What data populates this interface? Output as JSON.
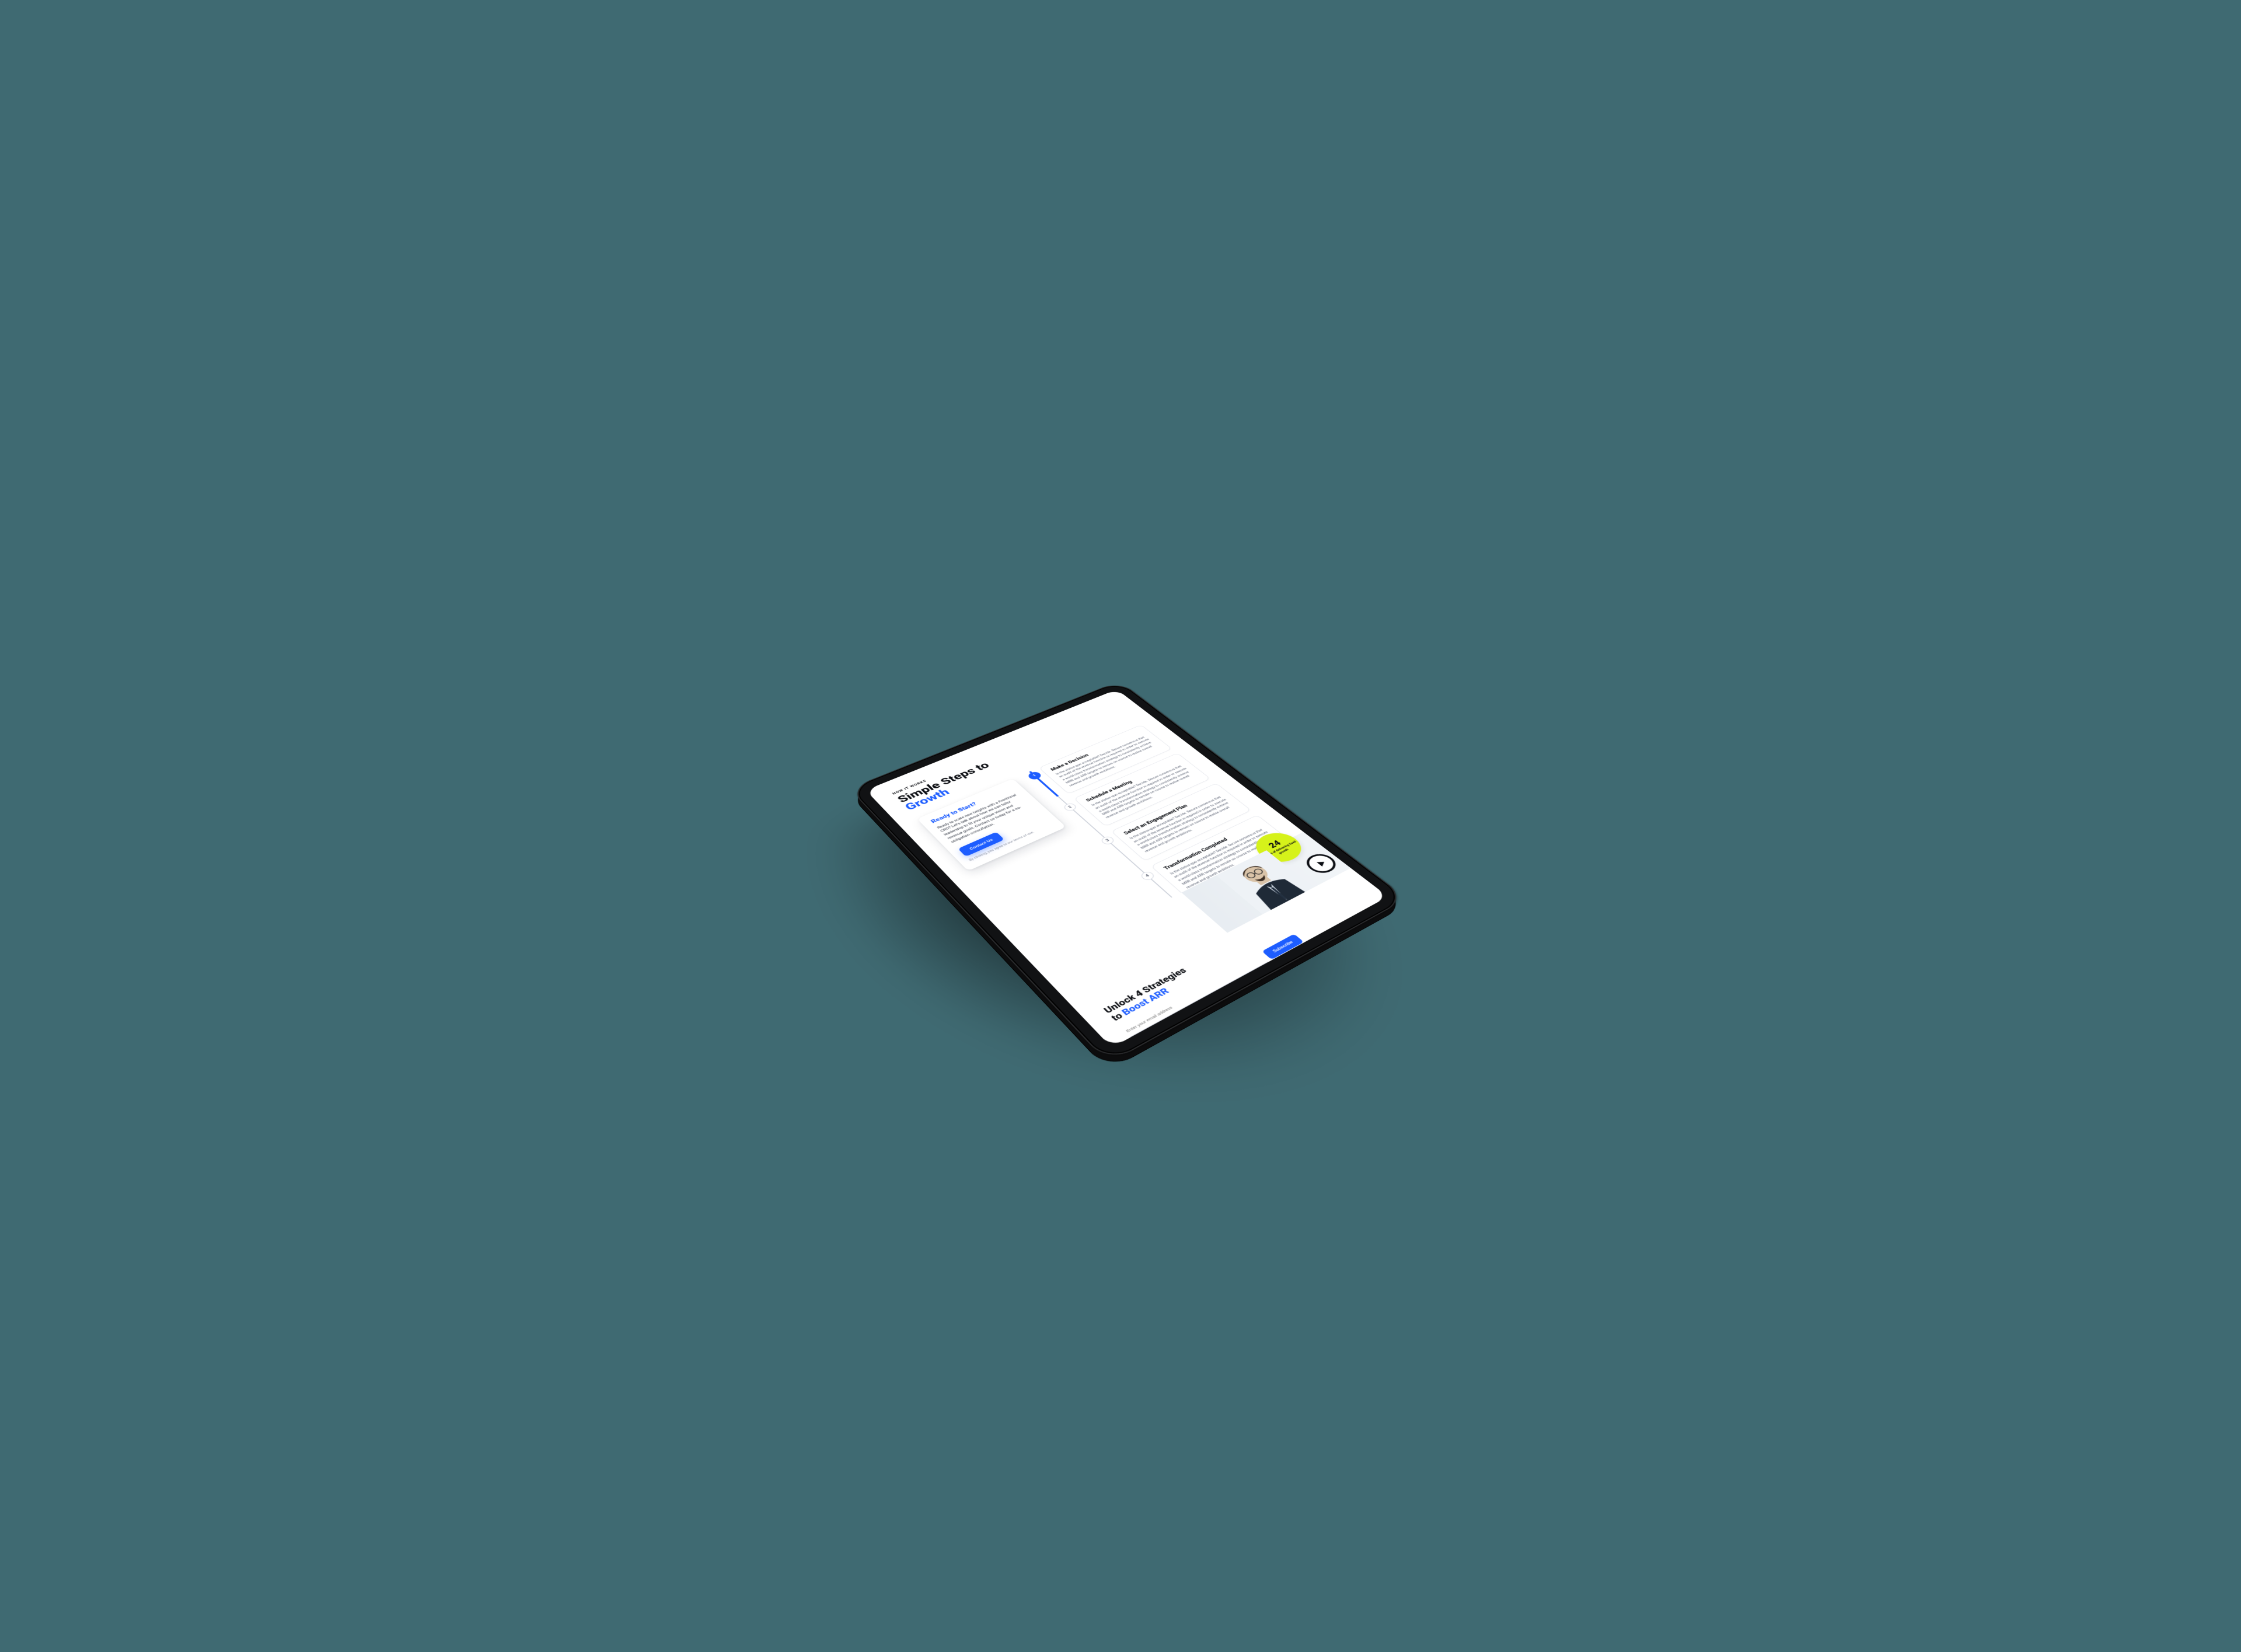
{
  "colors": {
    "background": "#3f6a72",
    "accent": "#1d5dff",
    "lime": "#d6f21a",
    "ink": "#0b0d12"
  },
  "header": {
    "eyebrow": "HOW IT WORKS",
    "title_a": "Simple Steps to",
    "title_b": "Growth"
  },
  "cta": {
    "title": "Ready to Start?",
    "body": "Ready to scale new heights with a Fractional CRO? Let's talk about how we can tailor leadership to fit your unique vision and revenue goals. Contact us today for a no-obligation consultation.",
    "button": "Contact Us",
    "footnote": "By clicking, you agree to our terms of use."
  },
  "steps": [
    {
      "n": "1",
      "title": "Make a Decision",
      "body": "Is the status-quo acceptable? Decide. Secure consensus that an audit of the revenue function is required in order to execute a world-class transformation strategy to consistently achieve MRR and ARR targets to remain on course to realise overall revenue and growth ambitions."
    },
    {
      "n": "2",
      "title": "Schedule a Meeting",
      "body": "Is the status-quo acceptable? Decide. Secure consensus that an audit of the revenue function is required in order to execute a world-class transformation strategy to consistently achieve MRR and ARR targets to remain on course to realise overall revenue and growth ambitions."
    },
    {
      "n": "3",
      "title": "Select an Engagement Plan",
      "body": "Is the status-quo acceptable? Decide. Secure consensus that an audit of the revenue function is required in order to execute a world-class transformation strategy to consistently achieve MRR and ARR targets to remain on course to realise overall revenue and growth ambitions."
    },
    {
      "n": "4",
      "title": "Transformation Completed",
      "body": "Is the status-quo acceptable? Decide. Secure consensus that an audit of the revenue function is required in order to execute a world-class transformation strategy to consistently achieve MRR and ARR targets to remain on course to realise overall revenue and growth ambitions."
    }
  ],
  "stamp": {
    "number": "24",
    "caption": "Years of delivering SaaS growth"
  },
  "subscribe": {
    "title_a": "Unlock 4 Strategies",
    "title_b": "to ",
    "title_c": "Boost ARR",
    "placeholder": "Enter your email address",
    "button": "Subscribe"
  }
}
